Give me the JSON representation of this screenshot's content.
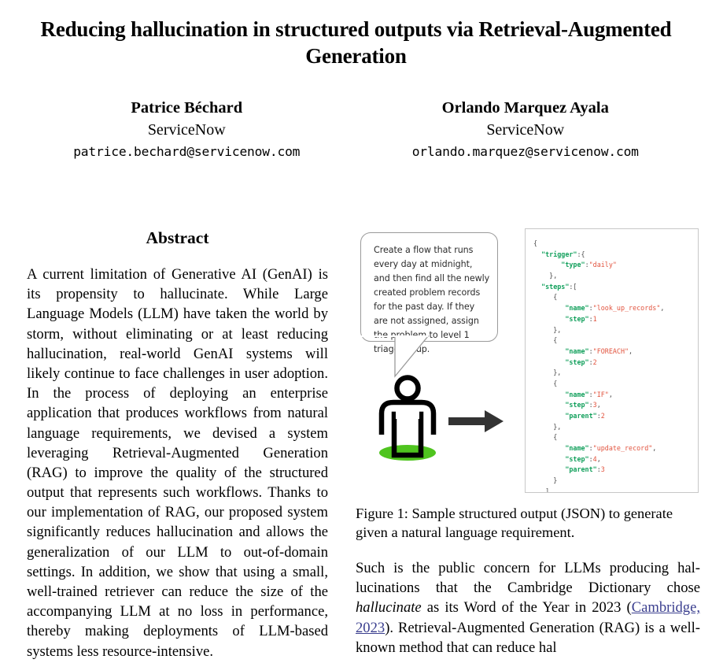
{
  "paper": {
    "title": "Reducing hallucination in structured outputs via Retrieval-Augmented Generation",
    "authors": [
      {
        "name": "Patrice Béchard",
        "affiliation": "ServiceNow",
        "email": "patrice.bechard@servicenow.com"
      },
      {
        "name": "Orlando Marquez Ayala",
        "affiliation": "ServiceNow",
        "email": "orlando.marquez@servicenow.com"
      }
    ],
    "abstract": {
      "heading": "Abstract",
      "text": "A current limitation of Generative AI (GenAI) is its propensity to hallucinate. While Large Language Models (LLM) have taken the world by storm, without eliminating or at least reduc­ing hallucination, real-world GenAI systems will likely continue to face challenges in user adoption. In the process of deploying an enter­prise application that produces workflows from natural language requirements, we devised a system leveraging Retrieval-Augmented Gen­eration (RAG) to improve the quality of the structured output that represents such work­flows. Thanks to our implementation of RAG, our proposed system significantly reduces hal­lucination and allows the generalization of our LLM to out-of-domain settings. In addition, we show that using a small, well-trained re­triever can reduce the size of the accompanying LLM at no loss in performance, thereby mak­ing deployments of LLM-based systems less resource-intensive."
    },
    "figure": {
      "bubble_text": "Create a flow that runs every day at midnight, and then find all the newly created problem records for the past day. If they are not assigned, assign the problem to level 1 triage group.",
      "person_icon": "person-icon",
      "arrow_icon": "right-arrow-icon",
      "json_output": "{\n  \"trigger\":{\n       \"type\":\"daily\"\n    },\n  \"steps\":[\n     {\n        \"name\":\"look_up_records\",\n        \"step\":1\n     },\n     {\n        \"name\":\"FOREACH\",\n        \"step\":2\n     },\n     {\n        \"name\":\"IF\",\n        \"step\":3,\n        \"parent\":2\n     },\n     {\n        \"name\":\"update_record\",\n        \"step\":4,\n        \"parent\":3\n     }\n   ]\n }",
      "caption": "Figure 1: Sample structured output (JSON) to generate given a natural language requirement."
    },
    "right_column": {
      "paragraph_parts": {
        "p1": "Such is the public concern for LLMs producing hal­lucinations that the Cambridge Dictionary chose ",
        "italic": "hallucinate",
        "p2": " as its Word of the Year in 2023 (",
        "citation": "Cam­bridge, 2023",
        "p3": "). Retrieval-Augmented Generation (RAG) is a well-known method that can reduce hal­"
      }
    },
    "colors": {
      "link": "#3b3f8f",
      "json_key": "#12a05c",
      "json_string": "#e2543f",
      "person_shadow_green": "#4fc41f",
      "bubble_border": "#9a9a9a",
      "code_border": "#c8c8c8"
    }
  }
}
